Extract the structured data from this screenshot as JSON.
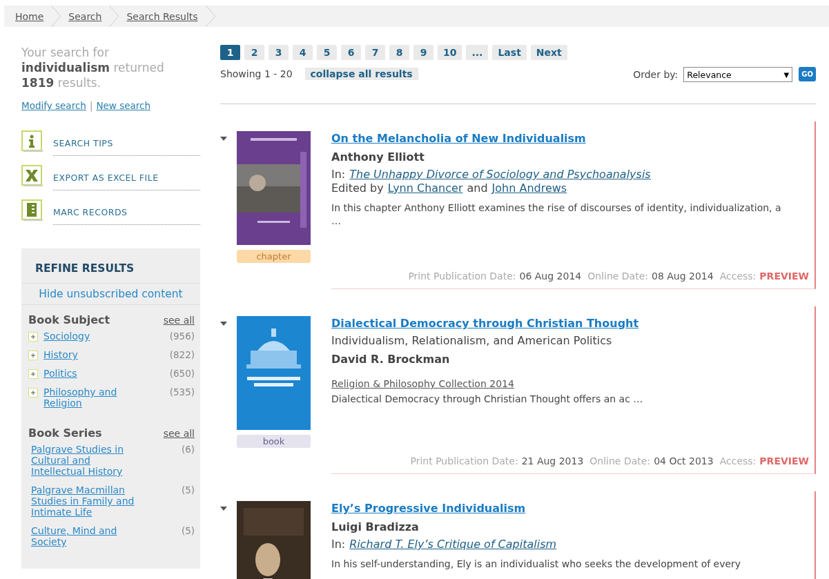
{
  "breadcrumbs": [
    {
      "label": "Home"
    },
    {
      "label": "Search"
    },
    {
      "label": "Search Results"
    }
  ],
  "search_summary": "Your search for **individualism** returned **1819** results.",
  "search_links": {
    "modify": "Modify search",
    "separator": "|",
    "new": "New search"
  },
  "tools": [
    {
      "kind": "info",
      "label": "SEARCH TIPS"
    },
    {
      "kind": "excel",
      "label": "EXPORT AS EXCEL FILE"
    },
    {
      "kind": "marc",
      "label": "MARC RECORDS"
    }
  ],
  "refine": {
    "title": "REFINE RESULTS",
    "hide_link": "Hide unsubscribed content",
    "facets": [
      {
        "title": "Book Subject",
        "see_all": "see all",
        "items": [
          {
            "label": "Sociology",
            "count": "(956)",
            "expandable": true
          },
          {
            "label": "History",
            "count": "(822)",
            "expandable": true
          },
          {
            "label": "Politics",
            "count": "(650)",
            "expandable": true
          },
          {
            "label": "Philosophy and Religion",
            "count": "(535)",
            "expandable": true
          }
        ]
      },
      {
        "title": "Book Series",
        "see_all": "see all",
        "items": [
          {
            "label": "Palgrave Studies in Cultural and Intellectual History",
            "count": "(6)",
            "expandable": false
          },
          {
            "label": "Palgrave Macmillan Studies in Family and Intimate Life",
            "count": "(5)",
            "expandable": false
          },
          {
            "label": "Culture, Mind and Society",
            "count": "(5)",
            "expandable": false
          }
        ]
      }
    ]
  },
  "pagination": [
    {
      "label": "1",
      "selected": true
    },
    {
      "label": "2",
      "selected": false
    },
    {
      "label": "3",
      "selected": false
    },
    {
      "label": "4",
      "selected": false
    },
    {
      "label": "5",
      "selected": false
    },
    {
      "label": "6",
      "selected": false
    },
    {
      "label": "7",
      "selected": false
    },
    {
      "label": "8",
      "selected": false
    },
    {
      "label": "9",
      "selected": false
    },
    {
      "label": "10",
      "selected": false
    },
    {
      "label": "...",
      "selected": false
    },
    {
      "label": "Last",
      "selected": false
    },
    {
      "label": "Next",
      "selected": false
    }
  ],
  "showing": "Showing 1 - 20",
  "collapse": "collapse all results",
  "order_by": {
    "label": "Order by:",
    "value": "Relevance",
    "caret": "▼",
    "go": "GO"
  },
  "results": [
    {
      "kind": "chapter",
      "badge": "chapter",
      "title": "On the Melancholia of New Individualism",
      "author": "Anthony Elliott",
      "in_label": "In:",
      "in_title": "The Unhappy Divorce of Sociology and Psychoanalysis",
      "edited_prefix": "Edited by",
      "editors": [
        "Lynn Chancer",
        "John Andrews"
      ],
      "editors_joiner": "and",
      "abstract": "In this chapter Anthony Elliott examines the rise of discourses of identity, individualization, a …",
      "print_label": "Print Publication Date:",
      "print_date": "06 Aug 2014",
      "online_label": "Online Date:",
      "online_date": "08 Aug 2014",
      "access_label": "Access:",
      "access": "PREVIEW"
    },
    {
      "kind": "book",
      "badge": "book",
      "title": "Dialectical Democracy through Christian Thought",
      "subtitle": "Individualism, Relationalism, and American Politics",
      "author": "David R. Brockman",
      "collection": "Religion & Philosophy Collection 2014",
      "abstract": "Dialectical Democracy through Christian Thought offers an ac …",
      "print_label": "Print Publication Date:",
      "print_date": "21 Aug 2013",
      "online_label": "Online Date:",
      "online_date": "04 Oct 2013",
      "access_label": "Access:",
      "access": "PREVIEW"
    },
    {
      "title": "Ely’s Progressive Individualism",
      "author": "Luigi Bradizza",
      "in_label": "In:",
      "in_title": "Richard T. Ely’s Critique of Capitalism",
      "abstract": "In his self-understanding, Ely is an individualist who seeks the development of every"
    }
  ]
}
